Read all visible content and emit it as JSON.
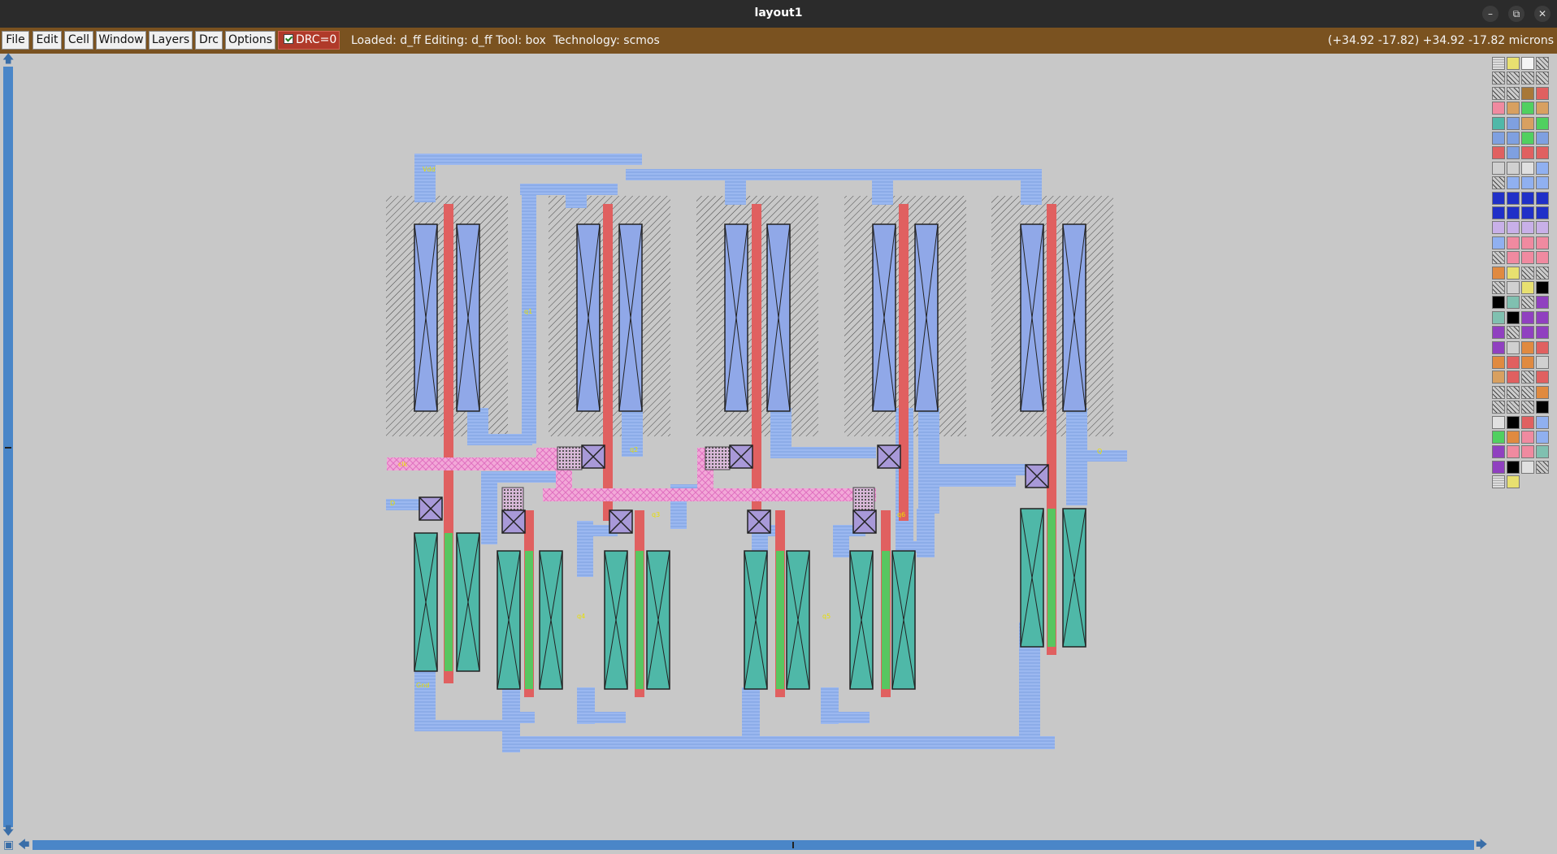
{
  "window": {
    "title": "layout1"
  },
  "menu": {
    "items": [
      "File",
      "Edit",
      "Cell",
      "Window",
      "Layers",
      "Drc",
      "Options"
    ],
    "drc_label": "DRC=0"
  },
  "status": {
    "text": "Loaded: d_ff Editing: d_ff Tool: box  Technology: scmos",
    "coords": "(+34.92 -17.82) +34.92 -17.82 microns"
  },
  "colors": {
    "titlebar": "#2b2b2b",
    "menubar": "#7a5220",
    "canvas": "#c8c8c8",
    "metal1": "#9bb8f0",
    "poly": "#e06060",
    "pdiff": "#e88ac8",
    "ndiff": "#4fb8a8",
    "well": "#555555",
    "scroll": "#4a86c8"
  },
  "palette": {
    "swatches": [
      "grid",
      "yellow",
      "white",
      "hatch",
      "hatch",
      "hatch",
      "hatch",
      "hatch",
      "hatch",
      "hatch",
      "brown",
      "red",
      "pink",
      "tan",
      "green",
      "tan",
      "cyan-x",
      "blue-x",
      "tan",
      "green",
      "blue-x",
      "blue-x",
      "green",
      "blue-x",
      "red",
      "blue-x",
      "red",
      "red",
      "gray",
      "gray",
      "black-x",
      "blue",
      "hatch",
      "blue",
      "blue",
      "blue",
      "navy",
      "navy",
      "navy",
      "navy",
      "navy",
      "navy",
      "navy",
      "navy",
      "lavender",
      "lavender",
      "lavender",
      "lavender",
      "blue",
      "pink",
      "pink",
      "pink",
      "hatch",
      "pink",
      "pink",
      "pink",
      "orange",
      "yellow",
      "hatch",
      "hatch",
      "hatch",
      "gray",
      "yellow",
      "black",
      "black",
      "teal",
      "hatch",
      "purple",
      "teal",
      "black",
      "purple",
      "purple",
      "purple",
      "hatch",
      "purple",
      "purple",
      "purple",
      "gray",
      "orange",
      "red",
      "orange",
      "red",
      "orange",
      "gray",
      "tan",
      "red",
      "hatch",
      "red",
      "hatch",
      "hatch",
      "hatch",
      "orange",
      "hatch",
      "hatch",
      "hatch",
      "black",
      "black-x",
      "black",
      "red",
      "blue",
      "green",
      "orange",
      "pink",
      "blue",
      "purple",
      "pink",
      "pink",
      "teal",
      "purple",
      "black",
      "black-x",
      "hatch",
      "grid",
      "yellow"
    ]
  }
}
